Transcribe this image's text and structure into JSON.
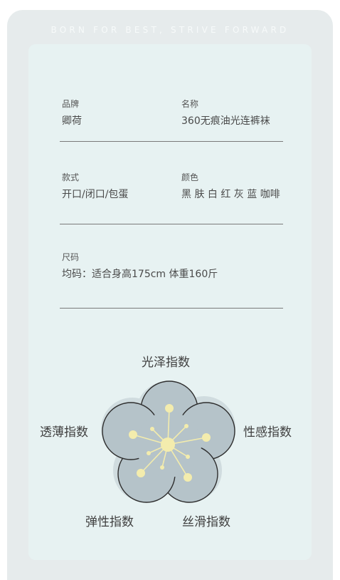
{
  "slogan": "BORN FOR BEST, STRIVE FORWARD",
  "specs": {
    "brand": {
      "label": "品牌",
      "value": "卿荷"
    },
    "name": {
      "label": "名称",
      "value": "360无痕油光连裤袜"
    },
    "style": {
      "label": "款式",
      "value": "开口/闭口/包蛋"
    },
    "color": {
      "label": "颜色",
      "value": "黑 肤 白 红 灰 蓝 咖啡"
    },
    "size": {
      "label": "尺码",
      "value": "均码：适合身高175cm 体重160斤"
    }
  },
  "indices": {
    "gloss": "光泽指数",
    "sexy": "性感指数",
    "smooth": "丝滑指数",
    "elastic": "弹性指数",
    "sheer": "透薄指数"
  },
  "colors": {
    "outer_bg": "#e6ebec",
    "card_bg": "#e7f2f2",
    "flower_fill": "#b5c3c9",
    "flower_back": "#d0dcdf",
    "stamen": "#f3ecad"
  }
}
